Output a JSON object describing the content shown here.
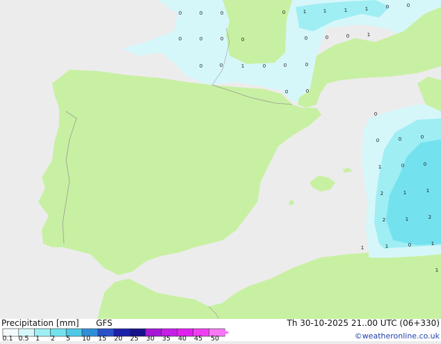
{
  "title": "Precipitation [mm]",
  "model": "GFS",
  "valid_time": "Th 30-10-2025 21..00 UTC (06+330)",
  "credit": "©weatheronline.co.uk",
  "legend": {
    "ticks": [
      "0.1",
      "0.5",
      "1",
      "2",
      "5",
      "10",
      "15",
      "20",
      "25",
      "30",
      "35",
      "40",
      "45",
      "50"
    ],
    "colors": [
      "#f4fbfd",
      "#d6f7fa",
      "#9feef4",
      "#73e2ee",
      "#4fc8e6",
      "#2f8fd6",
      "#2a52c8",
      "#1d20a8",
      "#16128a",
      "#a617d6",
      "#c51ee6",
      "#e020ee",
      "#ef3ef2",
      "#f777f4"
    ]
  },
  "colors": {
    "sea": "#ececec",
    "land": "#c8f0a2",
    "precip_light": "#d6f7fa",
    "precip_medium": "#9feef4",
    "precip_heavy": "#73e2ee",
    "border": "#9a9a9a"
  },
  "point_values": [
    "0",
    "0",
    "0",
    "0",
    "1",
    "1",
    "1",
    "1",
    "0",
    "0",
    "0",
    "0",
    "0",
    "0",
    "0",
    "0",
    "0",
    "1",
    "0",
    "0",
    "1",
    "0",
    "0",
    "0",
    "0",
    "0",
    "0",
    "0",
    "0",
    "0",
    "1",
    "0",
    "0",
    "2",
    "1",
    "1",
    "2",
    "1",
    "2",
    "1",
    "1",
    "0",
    "1",
    "1",
    "1",
    "0"
  ]
}
